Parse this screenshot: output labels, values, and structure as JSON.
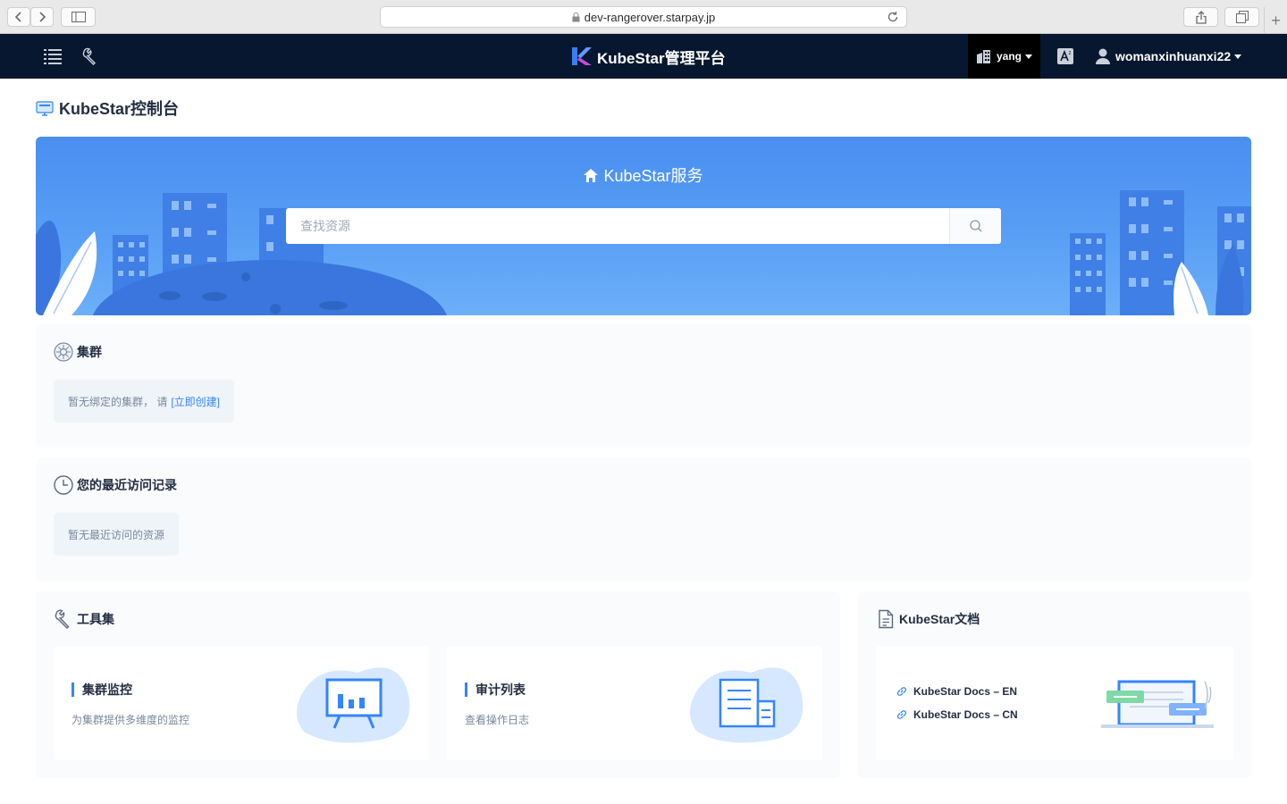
{
  "browser": {
    "url": "dev-rangerover.starpay.jp"
  },
  "nav": {
    "brand": "KubeStar管理平台",
    "workspace": "yang",
    "user": "womanxinhuanxi22",
    "icons": [
      "list-icon",
      "wrench-icon",
      "building-icon",
      "translate-icon",
      "user-icon"
    ]
  },
  "page": {
    "title": "KubeStar控制台"
  },
  "banner": {
    "title": "KubeStar服务",
    "search_placeholder": "查找资源"
  },
  "clusters": {
    "title": "集群",
    "empty_text": "暂无绑定的集群，  请",
    "create_link": "[立即创建]"
  },
  "recent": {
    "title": "您的最近访问记录",
    "empty_text": "暂无最近访问的资源"
  },
  "tools": {
    "title": "工具集",
    "items": [
      {
        "title": "集群监控",
        "desc": "为集群提供多维度的监控"
      },
      {
        "title": "审计列表",
        "desc": "查看操作日志"
      }
    ]
  },
  "docs": {
    "title": "KubeStar文档",
    "links": [
      "KubeStar Docs – EN",
      "KubeStar Docs – CN"
    ]
  },
  "colors": {
    "nav_bg": "#07172f",
    "accent": "#3385ff",
    "banner": "#4a8ef0",
    "panel_bg": "#f9fbfd"
  }
}
